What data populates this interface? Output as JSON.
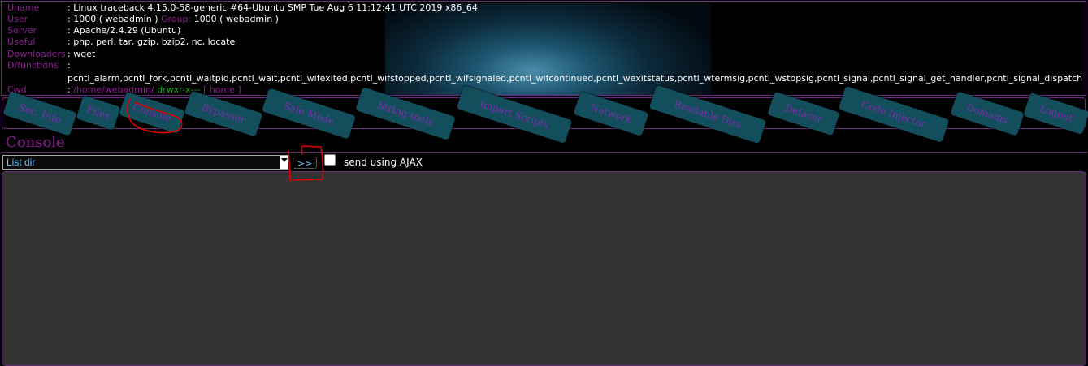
{
  "header": {
    "uname_key": "Uname",
    "uname_val": ": Linux traceback 4.15.0-58-generic #64-Ubuntu SMP Tue Aug 6 11:12:41 UTC 2019 x86_64",
    "user_key": "User",
    "user_val": ": 1000 ( webadmin )",
    "group_key": "Group:",
    "group_val": "1000 ( webadmin )",
    "server_key": "Server",
    "server_val": ": Apache/2.4.29 (Ubuntu)",
    "useful_key": "Useful",
    "useful_val": ": php, perl, tar, gzip, bzip2, nc, locate",
    "downloaders_key": "Downloaders",
    "downloaders_val": ": wget",
    "dfunctions_key": "D/functions",
    "dfunctions_val": ":",
    "dfunctions_list": "pcntl_alarm,pcntl_fork,pcntl_waitpid,pcntl_wait,pcntl_wifexited,pcntl_wifstopped,pcntl_wifsignaled,pcntl_wifcontinued,pcntl_wexitstatus,pcntl_wtermsig,pcntl_wstopsig,pcntl_signal,pcntl_signal_get_handler,pcntl_signal_dispatch",
    "cwd_key": "Cwd",
    "cwd_sep": ":",
    "cwd_path": "/home/webadmin/",
    "cwd_perms": "drwxr-x---",
    "cwd_home": "[ home ]"
  },
  "menu": {
    "tabs": [
      "Sec. Info",
      "Files",
      "Console",
      "Bypasser",
      "Safe Mode",
      "String tools",
      "Import Scripts",
      "Network",
      "Readable Dirs",
      "Defacer",
      "Code Injector",
      "Domains",
      "Logout"
    ]
  },
  "console": {
    "title": "Console",
    "selected_command": "List dir",
    "go_label": ">>",
    "ajax_label": "send using AJAX",
    "ajax_checked": false,
    "output": ""
  },
  "colors": {
    "accent": "#8b1f8f",
    "tab_bg": "#134e5c",
    "perms_green": "#1fa31f",
    "annotation_red": "#e00000"
  }
}
